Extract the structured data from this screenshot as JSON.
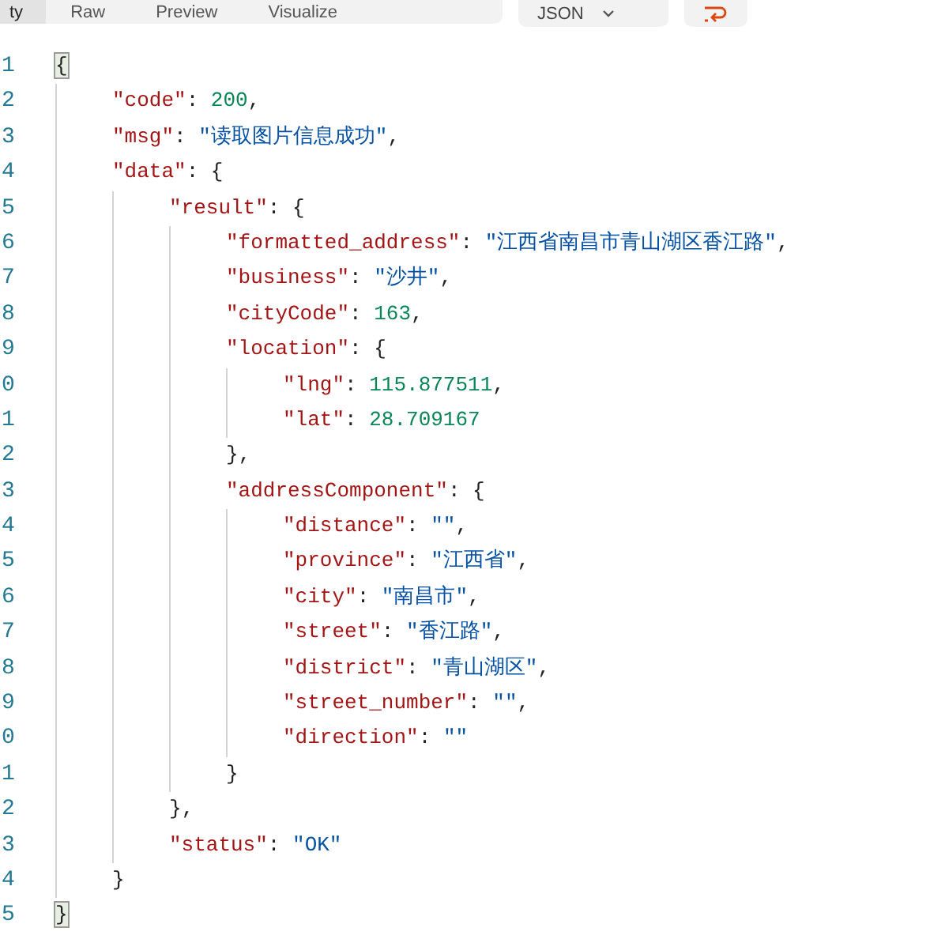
{
  "toolbar": {
    "view_tabs": [
      {
        "label": "ty",
        "selected": true
      },
      {
        "label": "Raw",
        "selected": false
      },
      {
        "label": "Preview",
        "selected": false
      },
      {
        "label": "Visualize",
        "selected": false
      }
    ],
    "format_dropdown": {
      "value": "JSON"
    }
  },
  "code_lines": [
    {
      "number": "1",
      "tokens": [
        {
          "kind": "brace",
          "text": "{",
          "highlighted": true
        }
      ],
      "children": [
        {
          "number": "2",
          "tokens": [
            {
              "kind": "key",
              "text": "\"code\""
            },
            {
              "kind": "punct",
              "text": ": "
            },
            {
              "kind": "number",
              "text": "200"
            },
            {
              "kind": "punct",
              "text": ","
            }
          ]
        },
        {
          "number": "3",
          "tokens": [
            {
              "kind": "key",
              "text": "\"msg\""
            },
            {
              "kind": "punct",
              "text": ": "
            },
            {
              "kind": "string",
              "text": "\"读取图片信息成功\""
            },
            {
              "kind": "punct",
              "text": ","
            }
          ]
        },
        {
          "number": "4",
          "tokens": [
            {
              "kind": "key",
              "text": "\"data\""
            },
            {
              "kind": "punct",
              "text": ": "
            },
            {
              "kind": "brace",
              "text": "{",
              "highlighted": false
            }
          ],
          "children": [
            {
              "number": "5",
              "tokens": [
                {
                  "kind": "key",
                  "text": "\"result\""
                },
                {
                  "kind": "punct",
                  "text": ": "
                },
                {
                  "kind": "brace",
                  "text": "{",
                  "highlighted": false
                }
              ],
              "children": [
                {
                  "number": "6",
                  "tokens": [
                    {
                      "kind": "key",
                      "text": "\"formatted_address\""
                    },
                    {
                      "kind": "punct",
                      "text": ": "
                    },
                    {
                      "kind": "string",
                      "text": "\"江西省南昌市青山湖区香江路\""
                    },
                    {
                      "kind": "punct",
                      "text": ","
                    }
                  ]
                },
                {
                  "number": "7",
                  "tokens": [
                    {
                      "kind": "key",
                      "text": "\"business\""
                    },
                    {
                      "kind": "punct",
                      "text": ": "
                    },
                    {
                      "kind": "string",
                      "text": "\"沙井\""
                    },
                    {
                      "kind": "punct",
                      "text": ","
                    }
                  ]
                },
                {
                  "number": "8",
                  "tokens": [
                    {
                      "kind": "key",
                      "text": "\"cityCode\""
                    },
                    {
                      "kind": "punct",
                      "text": ": "
                    },
                    {
                      "kind": "number",
                      "text": "163"
                    },
                    {
                      "kind": "punct",
                      "text": ","
                    }
                  ]
                },
                {
                  "number": "9",
                  "tokens": [
                    {
                      "kind": "key",
                      "text": "\"location\""
                    },
                    {
                      "kind": "punct",
                      "text": ": "
                    },
                    {
                      "kind": "brace",
                      "text": "{",
                      "highlighted": false
                    }
                  ],
                  "children": [
                    {
                      "number": "0",
                      "tokens": [
                        {
                          "kind": "key",
                          "text": "\"lng\""
                        },
                        {
                          "kind": "punct",
                          "text": ": "
                        },
                        {
                          "kind": "number",
                          "text": "115.877511"
                        },
                        {
                          "kind": "punct",
                          "text": ","
                        }
                      ]
                    },
                    {
                      "number": "1",
                      "tokens": [
                        {
                          "kind": "key",
                          "text": "\"lat\""
                        },
                        {
                          "kind": "punct",
                          "text": ": "
                        },
                        {
                          "kind": "number",
                          "text": "28.709167"
                        }
                      ]
                    }
                  ]
                },
                {
                  "number": "2",
                  "tokens": [
                    {
                      "kind": "brace",
                      "text": "}",
                      "highlighted": false
                    },
                    {
                      "kind": "punct",
                      "text": ","
                    }
                  ]
                },
                {
                  "number": "3",
                  "tokens": [
                    {
                      "kind": "key",
                      "text": "\"addressComponent\""
                    },
                    {
                      "kind": "punct",
                      "text": ": "
                    },
                    {
                      "kind": "brace",
                      "text": "{",
                      "highlighted": false
                    }
                  ],
                  "children": [
                    {
                      "number": "4",
                      "tokens": [
                        {
                          "kind": "key",
                          "text": "\"distance\""
                        },
                        {
                          "kind": "punct",
                          "text": ": "
                        },
                        {
                          "kind": "string",
                          "text": "\"\""
                        },
                        {
                          "kind": "punct",
                          "text": ","
                        }
                      ]
                    },
                    {
                      "number": "5",
                      "tokens": [
                        {
                          "kind": "key",
                          "text": "\"province\""
                        },
                        {
                          "kind": "punct",
                          "text": ": "
                        },
                        {
                          "kind": "string",
                          "text": "\"江西省\""
                        },
                        {
                          "kind": "punct",
                          "text": ","
                        }
                      ]
                    },
                    {
                      "number": "6",
                      "tokens": [
                        {
                          "kind": "key",
                          "text": "\"city\""
                        },
                        {
                          "kind": "punct",
                          "text": ": "
                        },
                        {
                          "kind": "string",
                          "text": "\"南昌市\""
                        },
                        {
                          "kind": "punct",
                          "text": ","
                        }
                      ]
                    },
                    {
                      "number": "7",
                      "tokens": [
                        {
                          "kind": "key",
                          "text": "\"street\""
                        },
                        {
                          "kind": "punct",
                          "text": ": "
                        },
                        {
                          "kind": "string",
                          "text": "\"香江路\""
                        },
                        {
                          "kind": "punct",
                          "text": ","
                        }
                      ]
                    },
                    {
                      "number": "8",
                      "tokens": [
                        {
                          "kind": "key",
                          "text": "\"district\""
                        },
                        {
                          "kind": "punct",
                          "text": ": "
                        },
                        {
                          "kind": "string",
                          "text": "\"青山湖区\""
                        },
                        {
                          "kind": "punct",
                          "text": ","
                        }
                      ]
                    },
                    {
                      "number": "9",
                      "tokens": [
                        {
                          "kind": "key",
                          "text": "\"street_number\""
                        },
                        {
                          "kind": "punct",
                          "text": ": "
                        },
                        {
                          "kind": "string",
                          "text": "\"\""
                        },
                        {
                          "kind": "punct",
                          "text": ","
                        }
                      ]
                    },
                    {
                      "number": "0",
                      "tokens": [
                        {
                          "kind": "key",
                          "text": "\"direction\""
                        },
                        {
                          "kind": "punct",
                          "text": ": "
                        },
                        {
                          "kind": "string",
                          "text": "\"\""
                        }
                      ]
                    }
                  ]
                },
                {
                  "number": "1",
                  "tokens": [
                    {
                      "kind": "brace",
                      "text": "}",
                      "highlighted": false
                    }
                  ]
                }
              ]
            },
            {
              "number": "2",
              "tokens": [
                {
                  "kind": "brace",
                  "text": "}",
                  "highlighted": false
                },
                {
                  "kind": "punct",
                  "text": ","
                }
              ]
            },
            {
              "number": "3",
              "tokens": [
                {
                  "kind": "key",
                  "text": "\"status\""
                },
                {
                  "kind": "punct",
                  "text": ": "
                },
                {
                  "kind": "string",
                  "text": "\"OK\""
                }
              ]
            }
          ]
        },
        {
          "number": "4",
          "tokens": [
            {
              "kind": "brace",
              "text": "}",
              "highlighted": false
            }
          ]
        }
      ]
    },
    {
      "number": "5",
      "tokens": [
        {
          "kind": "brace",
          "text": "}",
          "highlighted": true
        }
      ]
    }
  ]
}
